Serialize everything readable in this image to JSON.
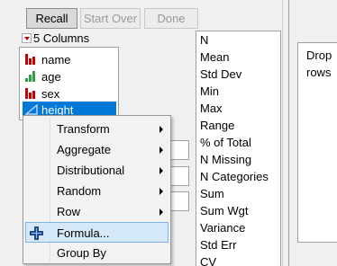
{
  "toolbar": {
    "recall": "Recall",
    "start_over": "Start Over",
    "done": "Done"
  },
  "columns": {
    "header": "5 Columns",
    "items": [
      {
        "label": "name",
        "icon": "nominal-icon"
      },
      {
        "label": "age",
        "icon": "ordinal-icon"
      },
      {
        "label": "sex",
        "icon": "nominal-icon"
      },
      {
        "label": "height",
        "icon": "continuous-icon",
        "selected": true
      }
    ]
  },
  "stats": [
    "N",
    "Mean",
    "Std Dev",
    "Min",
    "Max",
    "Range",
    "% of Total",
    "N Missing",
    "N Categories",
    "Sum",
    "Sum Wgt",
    "Variance",
    "Std Err",
    "CV"
  ],
  "right_panel": {
    "drop_text": "Drop\nrows"
  },
  "menu": {
    "items": [
      {
        "label": "Transform",
        "submenu": true
      },
      {
        "label": "Aggregate",
        "submenu": true
      },
      {
        "label": "Distributional",
        "submenu": true
      },
      {
        "label": "Random",
        "submenu": true
      },
      {
        "label": "Row",
        "submenu": true
      },
      {
        "label": "Formula...",
        "submenu": false,
        "highlighted": true
      },
      {
        "label": "Group By",
        "submenu": false
      }
    ]
  },
  "colors": {
    "nominal": "#c40000",
    "ordinal": "#2ea043",
    "continuous": "#2a5bd7",
    "selection": "#0078d7",
    "highlight": "#d5e8f8"
  }
}
